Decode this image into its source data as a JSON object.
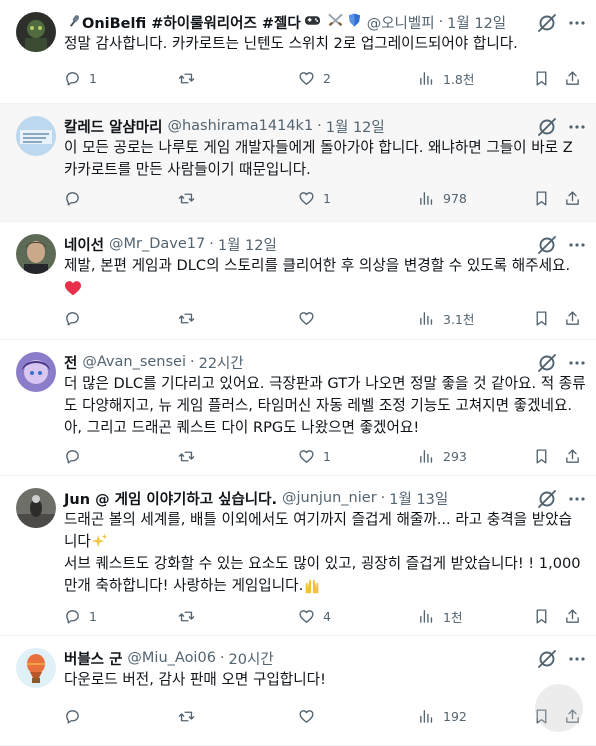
{
  "tweets": [
    {
      "display_name": "OniBelfi #하이룰워리어즈 #젤다",
      "handle": "@오니벨피",
      "time": "1월 12일",
      "lines": [
        "정말 감사합니다. 카카로트는 닌텐도 스위치 2로 업그레이드되어야 합니다."
      ],
      "replies": "1",
      "retweets": "",
      "likes": "2",
      "views": "1.8천"
    },
    {
      "display_name": "칼레드 알샴마리",
      "handle": "@hashirama1414k1",
      "time": "1월 12일",
      "lines": [
        "이 모든 공로는 나루토 게임 개발자들에게 돌아가야 합니다. 왜냐하면 그들이 바로 Z",
        "카카로트를 만든 사람들이기 때문입니다."
      ],
      "replies": "",
      "retweets": "",
      "likes": "1",
      "views": "978"
    },
    {
      "display_name": "네이선",
      "handle": "@Mr_Dave17",
      "time": "1월 12일",
      "lines": [
        "제발, 본편 게임과 DLC의 스토리를 클리어한 후 의상을 변경할 수 있도록 해주세요."
      ],
      "replies": "",
      "retweets": "",
      "likes": "",
      "views": "3.1천"
    },
    {
      "display_name": "전",
      "handle": "@Avan_sensei",
      "time": "22시간",
      "lines": [
        "더 많은 DLC를 기다리고 있어요. 극장판과 GT가 나오면 정말 좋을 것 같아요. 적 종류",
        "도 다양해지고, 뉴 게임 플러스, 타임머신 자동 레벨 조정 기능도 고쳐지면 좋겠네요.",
        "아, 그리고 드래곤 퀘스트 다이 RPG도 나왔으면 좋겠어요!"
      ],
      "replies": "",
      "retweets": "",
      "likes": "1",
      "views": "293"
    },
    {
      "display_name": "Jun @ 게임 이야기하고 싶습니다.",
      "handle": "@junjun_nier",
      "time": "1월 13일",
      "lines": [
        "드래곤 볼의 세계를, 배틀 이외에서도 여기까지 즐겁게 해줄까... 라고 충격을 받았습",
        "니다",
        "서브 퀘스트도 강화할 수 있는 요소도 많이 있고, 굉장히 즐겁게 받았습니다! ! 1,000",
        "만개 축하합니다! 사랑하는 게임입니다."
      ],
      "replies": "1",
      "retweets": "",
      "likes": "4",
      "views": "1천"
    },
    {
      "display_name": "버블스 군",
      "handle": "@Miu_Aoi06",
      "time": "20시간",
      "lines": [
        "다운로드 버전, 감사 판매 오면 구입합니다!"
      ],
      "replies": "",
      "retweets": "",
      "likes": "",
      "views": "192"
    }
  ],
  "colors": {
    "text": "#0f1419",
    "muted": "#536471",
    "divider": "#eff3f4",
    "heart": "#e8304a",
    "verified": "#1d9bf0"
  },
  "icons": {
    "reply": "reply-icon",
    "retweet": "retweet-icon",
    "like": "heart-icon",
    "views": "views-icon",
    "bookmark": "bookmark-icon",
    "share": "share-icon",
    "grok": "grok-icon",
    "more": "more-icon"
  }
}
